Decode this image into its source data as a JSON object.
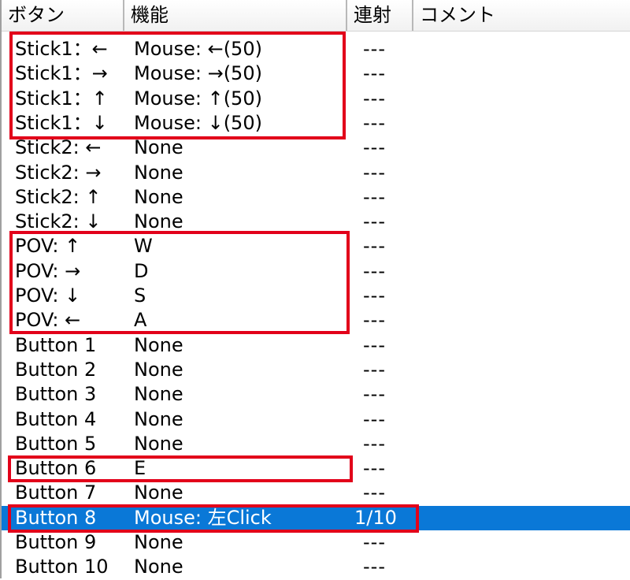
{
  "columns": [
    {
      "label": "ボタン"
    },
    {
      "label": "機能"
    },
    {
      "label": "連射"
    },
    {
      "label": "コメント"
    }
  ],
  "rows": [
    {
      "button": "Stick1：←",
      "function": "Mouse: ←(50)",
      "rapid": "---"
    },
    {
      "button": "Stick1：→",
      "function": "Mouse: →(50)",
      "rapid": "---"
    },
    {
      "button": "Stick1：↑",
      "function": "Mouse: ↑(50)",
      "rapid": "---"
    },
    {
      "button": "Stick1：↓",
      "function": "Mouse: ↓(50)",
      "rapid": "---"
    },
    {
      "button": "Stick2: ←",
      "function": "None",
      "rapid": "---"
    },
    {
      "button": "Stick2: →",
      "function": "None",
      "rapid": "---"
    },
    {
      "button": "Stick2: ↑",
      "function": "None",
      "rapid": "---"
    },
    {
      "button": "Stick2: ↓",
      "function": "None",
      "rapid": "---"
    },
    {
      "button": "POV: ↑",
      "function": "W",
      "rapid": "---"
    },
    {
      "button": "POV: →",
      "function": "D",
      "rapid": "---"
    },
    {
      "button": "POV: ↓",
      "function": "S",
      "rapid": "---"
    },
    {
      "button": "POV: ←",
      "function": "A",
      "rapid": "---"
    },
    {
      "button": "Button 1",
      "function": "None",
      "rapid": "---"
    },
    {
      "button": "Button 2",
      "function": "None",
      "rapid": "---"
    },
    {
      "button": "Button 3",
      "function": "None",
      "rapid": "---"
    },
    {
      "button": "Button 4",
      "function": "None",
      "rapid": "---"
    },
    {
      "button": "Button 5",
      "function": "None",
      "rapid": "---"
    },
    {
      "button": "Button 6",
      "function": "E",
      "rapid": "---"
    },
    {
      "button": "Button 7",
      "function": "None",
      "rapid": "---"
    },
    {
      "button": "Button 8",
      "function": "Mouse: 左Click",
      "rapid": "1/10",
      "selected": true
    },
    {
      "button": "Button 9",
      "function": "None",
      "rapid": "---"
    },
    {
      "button": "Button 10",
      "function": "None",
      "rapid": "---"
    }
  ],
  "colors": {
    "selection": "#0a78d7",
    "highlight_border": "#e2001a"
  }
}
